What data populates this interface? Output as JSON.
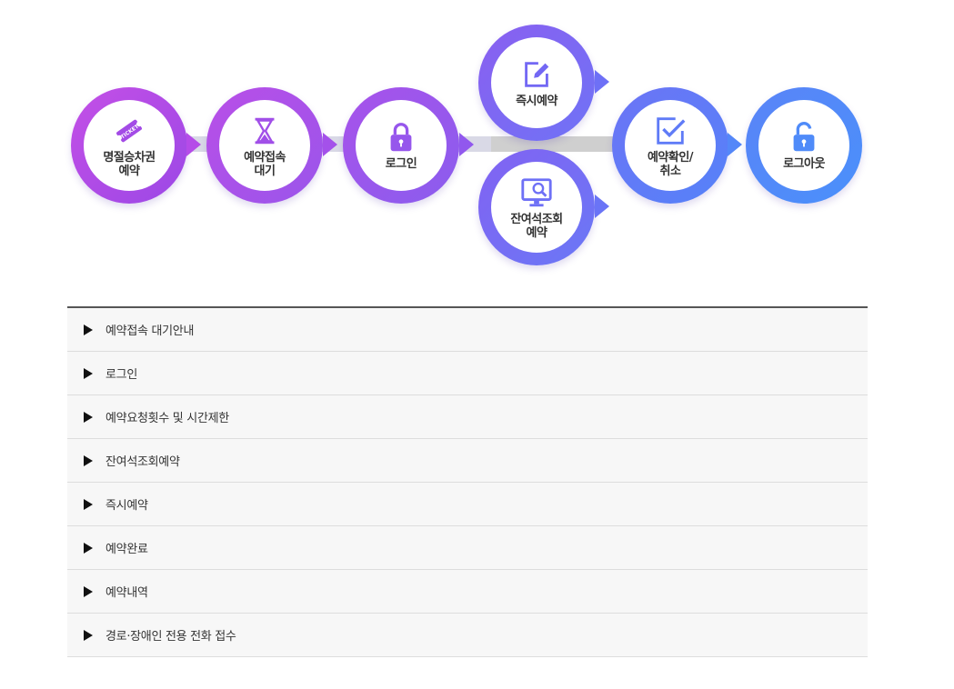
{
  "colors": {
    "purple": "#b44ce8",
    "violet": "#8f5ff0",
    "indigo": "#6e72f6",
    "blue": "#4c8cf8",
    "connector": "#cfcfcf",
    "text": "#333333"
  },
  "steps": [
    {
      "id": "pass",
      "label": "명절승차권\n예약",
      "icon": "ticket-icon",
      "colors": [
        "#c44fe6",
        "#9b48e6"
      ]
    },
    {
      "id": "wait",
      "label": "예약접속\n대기",
      "icon": "hourglass-icon",
      "colors": [
        "#b94fe8",
        "#9a55ea"
      ]
    },
    {
      "id": "login",
      "label": "로그인",
      "icon": "lock-icon",
      "colors": [
        "#a852ea",
        "#8a5dee"
      ]
    },
    {
      "id": "instant",
      "label": "즉시예약",
      "icon": "edit-icon",
      "colors": [
        "#8a5ff0",
        "#6f73f6"
      ]
    },
    {
      "id": "seat",
      "label": "잔여석조회\n예약",
      "icon": "monitor-search-icon",
      "colors": [
        "#8262f2",
        "#6a78f6"
      ]
    },
    {
      "id": "confirm",
      "label": "예약확인/\n취소",
      "icon": "checkbox-icon",
      "colors": [
        "#6c74f6",
        "#5582f8"
      ]
    },
    {
      "id": "logout",
      "label": "로그아웃",
      "icon": "unlock-icon",
      "colors": [
        "#5a84f8",
        "#4a90fa"
      ]
    }
  ],
  "accordion": [
    {
      "label": "예약접속 대기안내"
    },
    {
      "label": "로그인"
    },
    {
      "label": "예약요청횟수 및 시간제한"
    },
    {
      "label": "잔여석조회예약"
    },
    {
      "label": "즉시예약"
    },
    {
      "label": "예약완료"
    },
    {
      "label": "예약내역"
    },
    {
      "label": "경로·장애인 전용 전화 접수"
    }
  ]
}
